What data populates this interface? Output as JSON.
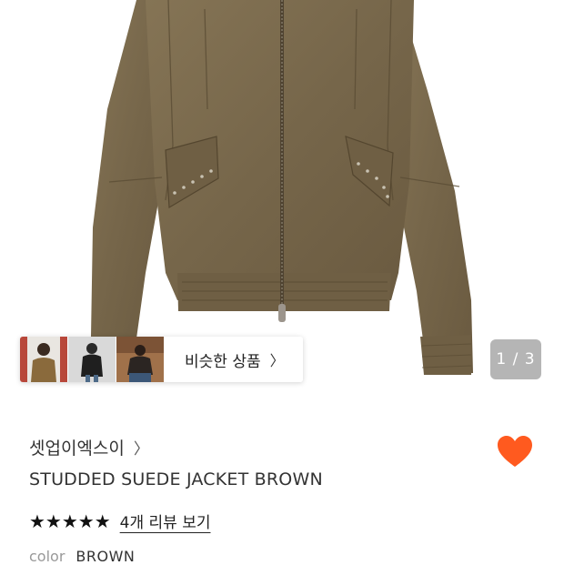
{
  "gallery": {
    "counter": "1 / 3",
    "similar_label": "비슷한 상품",
    "thumbnails": [
      "thumbnail-model-front",
      "thumbnail-model-black",
      "thumbnail-model-seated"
    ]
  },
  "product": {
    "brand": "셋업이엑스이",
    "name": "STUDDED SUEDE JACKET BROWN",
    "stars": "★★★★★",
    "review_link": "4개 리뷰 보기",
    "rating_value": 5,
    "option_key": "color",
    "option_value": "BROWN"
  },
  "colors": {
    "heart": "#ff5a1f",
    "jacket": "#7a6a4f",
    "jacket_dark": "#5e5038",
    "counter_bg": "#8a8a8a"
  }
}
